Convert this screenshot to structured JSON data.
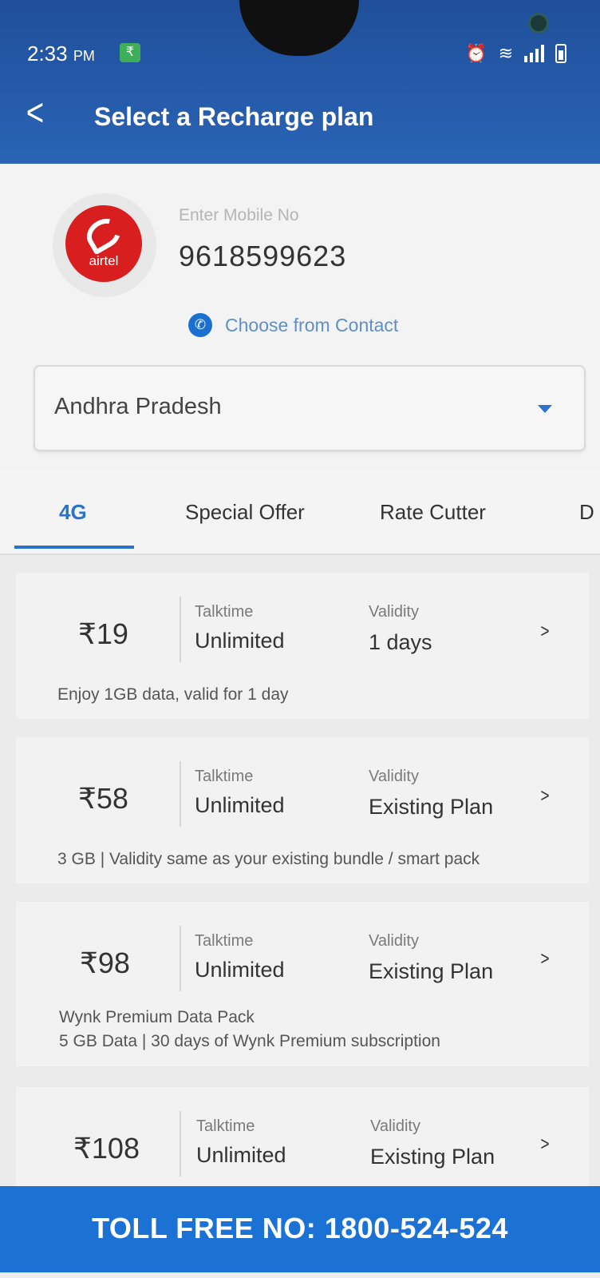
{
  "status": {
    "time": "2:33",
    "ampm": "PM"
  },
  "header": {
    "title": "Select a Recharge plan"
  },
  "operator": {
    "logo_text": "airtel"
  },
  "mobile": {
    "label": "Enter Mobile No",
    "value": "9618599623"
  },
  "contact": {
    "label": "Choose from Contact"
  },
  "state": {
    "selected": "Andhra Pradesh"
  },
  "tabs": [
    {
      "label": "4G",
      "active": true
    },
    {
      "label": "Special Offer",
      "active": false
    },
    {
      "label": "Rate Cutter",
      "active": false
    }
  ],
  "plans": [
    {
      "price": "₹19",
      "talktime_label": "Talktime",
      "talktime": "Unlimited",
      "validity_label": "Validity",
      "validity": "1 days",
      "description": "Enjoy 1GB data, valid for 1 day"
    },
    {
      "price": "₹58",
      "talktime_label": "Talktime",
      "talktime": "Unlimited",
      "validity_label": "Validity",
      "validity": "Existing Plan",
      "description": "3 GB | Validity same as your existing bundle / smart pack"
    },
    {
      "price": "₹98",
      "talktime_label": "Talktime",
      "talktime": "Unlimited",
      "validity_label": "Validity",
      "validity": "Existing Plan",
      "description": "Wynk Premium Data Pack",
      "description2": "5 GB Data | 30 days of Wynk Premium subscription"
    },
    {
      "price": "₹108",
      "talktime_label": "Talktime",
      "talktime": "Unlimited",
      "validity_label": "Validity",
      "validity": "Existing Plan"
    }
  ],
  "footer": {
    "text": "TOLL FREE NO: 1800-524-524"
  },
  "colors": {
    "header": "#2a63b5",
    "accent": "#2a73c8",
    "footer": "#1b72d4",
    "airtel_red": "#d81e1e"
  }
}
